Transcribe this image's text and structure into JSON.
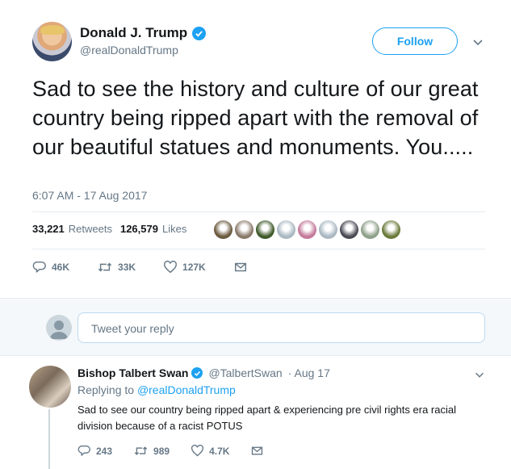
{
  "tweet": {
    "author_name": "Donald J. Trump",
    "handle": "@realDonaldTrump",
    "follow_label": "Follow",
    "text": "Sad to see the history and culture of our great country being ripped apart with the removal of our beautiful statues and monuments. You.....",
    "timestamp": "6:07 AM - 17 Aug 2017",
    "retweets_count": "33,221",
    "retweets_label": "Retweets",
    "likes_count": "126,579",
    "likes_label": "Likes",
    "liker_avatar_colors": [
      "#6b5a3e",
      "#8a7a6a",
      "#3f5a2a",
      "#aab8c2",
      "#c47a9a",
      "#aab8c2",
      "#4a4a55",
      "#8fa08a",
      "#6a7a3a"
    ],
    "actions": {
      "replies": "46K",
      "retweets": "33K",
      "likes": "127K"
    }
  },
  "reply_composer": {
    "placeholder": "Tweet your reply"
  },
  "reply": {
    "author_name": "Bishop Talbert Swan",
    "handle": "@TalbertSwan",
    "date": "· Aug 17",
    "replying_to_label": "Replying to",
    "replying_to_handle": "@realDonaldTrump",
    "text": "Sad to see our country being ripped apart & experiencing pre civil rights era racial division because of a racist POTUS",
    "actions": {
      "replies": "243",
      "retweets": "989",
      "likes": "4.7K"
    }
  },
  "colors": {
    "accent": "#1da1f2",
    "muted": "#657786",
    "text": "#14171a"
  }
}
